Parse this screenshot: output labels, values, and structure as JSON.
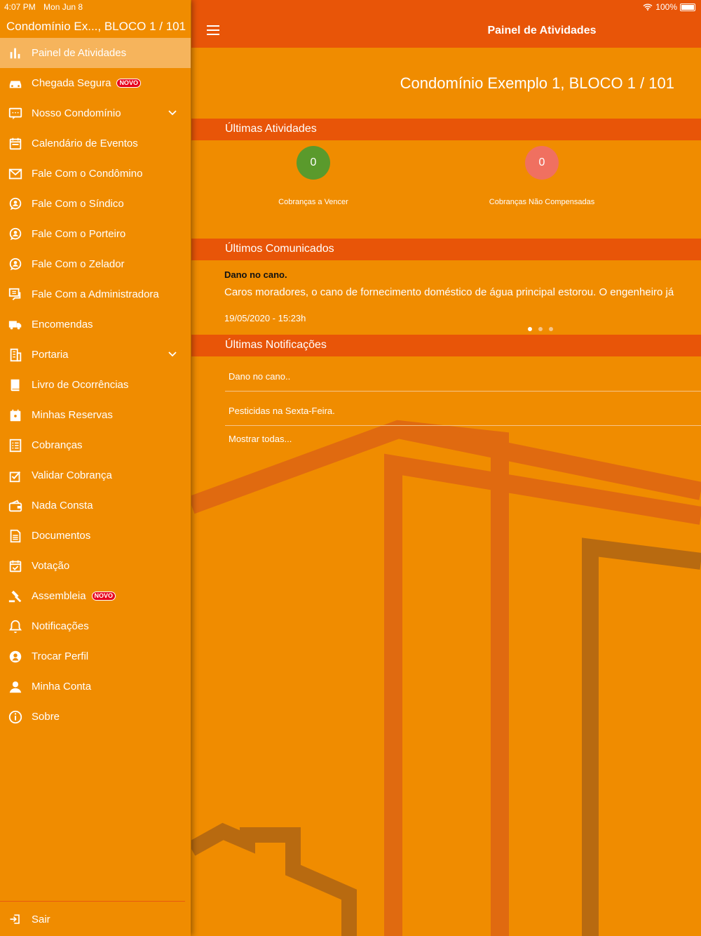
{
  "status": {
    "time": "4:07 PM",
    "date": "Mon Jun 8",
    "battery": "100%"
  },
  "sidebar": {
    "profile": "Condomínio Ex..., BLOCO 1 / 101",
    "items": [
      {
        "label": "Painel de Atividades",
        "icon": "bar-chart-icon",
        "active": true
      },
      {
        "label": "Chegada Segura",
        "icon": "car-icon",
        "badge": "NOVO"
      },
      {
        "label": "Nosso Condomínio",
        "icon": "chat-icon",
        "expandable": true
      },
      {
        "label": "Calendário de Eventos",
        "icon": "calendar-icon"
      },
      {
        "label": "Fale Com o Condômino",
        "icon": "mail-icon"
      },
      {
        "label": "Fale Com o Síndico",
        "icon": "person-chat-icon"
      },
      {
        "label": "Fale Com o Porteiro",
        "icon": "person-chat-icon"
      },
      {
        "label": "Fale Com o Zelador",
        "icon": "person-chat-icon"
      },
      {
        "label": "Fale Com a Administradora",
        "icon": "chats-icon"
      },
      {
        "label": "Encomendas",
        "icon": "truck-icon"
      },
      {
        "label": "Portaria",
        "icon": "building-icon",
        "expandable": true
      },
      {
        "label": "Livro de Ocorrências",
        "icon": "book-icon"
      },
      {
        "label": "Minhas Reservas",
        "icon": "reservation-icon"
      },
      {
        "label": "Cobranças",
        "icon": "list-icon"
      },
      {
        "label": "Validar Cobrança",
        "icon": "check-icon"
      },
      {
        "label": "Nada Consta",
        "icon": "wallet-icon"
      },
      {
        "label": "Documentos",
        "icon": "document-icon"
      },
      {
        "label": "Votação",
        "icon": "calendar-check-icon"
      },
      {
        "label": "Assembleia",
        "icon": "gavel-icon",
        "badge": "NOVO"
      },
      {
        "label": "Notificações",
        "icon": "bell-icon"
      },
      {
        "label": "Trocar Perfil",
        "icon": "profile-swap-icon"
      },
      {
        "label": "Minha Conta",
        "icon": "user-icon"
      },
      {
        "label": "Sobre",
        "icon": "info-icon"
      }
    ],
    "logout": "Sair"
  },
  "header": {
    "title": "Painel de Atividades"
  },
  "main": {
    "condo_name": "Condomínio Exemplo 1, BLOCO 1 / 101",
    "activities": {
      "title": "Últimas Atividades",
      "counters": [
        {
          "value": "0",
          "label": "Cobranças a Vencer",
          "color": "#5a9a2c"
        },
        {
          "value": "0",
          "label": "Cobranças Não Compensadas",
          "color": "#f07060"
        }
      ]
    },
    "notices": {
      "title": "Últimos Comunicados",
      "item_title": "Dano no cano.",
      "item_body": "Caros moradores, o cano de fornecimento doméstico de água principal estorou. O engenheiro já",
      "item_date": "19/05/2020 - 15:23h"
    },
    "notifications": {
      "title": "Últimas Notificações",
      "items": [
        "Dano no cano..",
        "Pesticidas na Sexta-Feira."
      ],
      "show_all": "Mostrar todas..."
    }
  },
  "colors": {
    "primary": "#f08c00",
    "header": "#e85508",
    "active": "#f6b45c"
  }
}
